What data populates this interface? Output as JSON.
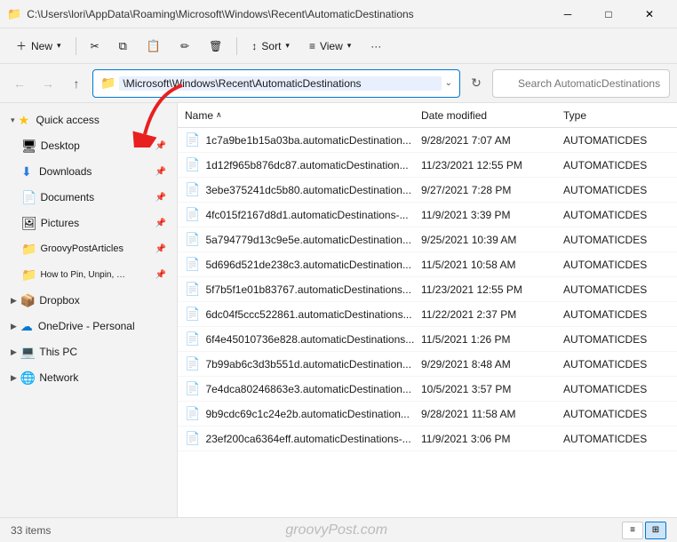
{
  "titleBar": {
    "path": "C:\\Users\\lori\\AppData\\Roaming\\Microsoft\\Windows\\Recent\\AutomaticDestinations",
    "minBtn": "─",
    "maxBtn": "□",
    "closeBtn": "✕"
  },
  "toolbar": {
    "newLabel": "+ New",
    "cutIcon": "✂",
    "copyIcon": "⧉",
    "pasteIcon": "📋",
    "renameIcon": "✏",
    "deleteIcon": "🗑",
    "sortLabel": "↕ Sort",
    "viewLabel": "≡ View",
    "moreLabel": "···",
    "newDropIcon": "▾"
  },
  "addressBar": {
    "backTitle": "Back",
    "forwardTitle": "Forward",
    "upTitle": "Up",
    "addressText": "\\Microsoft\\Windows\\Recent\\AutomaticDestinations",
    "searchPlaceholder": "Search AutomaticDestinations",
    "refreshTitle": "Refresh"
  },
  "sidebar": {
    "quickAccessLabel": "Quick access",
    "items": [
      {
        "id": "desktop",
        "label": "Desktop",
        "icon": "🖥",
        "pinned": true
      },
      {
        "id": "downloads",
        "label": "Downloads",
        "icon": "⬇",
        "pinned": true
      },
      {
        "id": "documents",
        "label": "Documents",
        "icon": "📄",
        "pinned": true
      },
      {
        "id": "pictures",
        "label": "Pictures",
        "icon": "🖼",
        "pinned": true
      },
      {
        "id": "groovypostarticles",
        "label": "GroovyPostArticles",
        "icon": "📁",
        "pinned": true
      },
      {
        "id": "howtopin",
        "label": "How to Pin, Unpin, Hide, and Re",
        "icon": "📁",
        "pinned": true
      }
    ],
    "dropbox": {
      "label": "Dropbox",
      "icon": "📦"
    },
    "onedrive": {
      "label": "OneDrive - Personal",
      "icon": "☁"
    },
    "thispc": {
      "label": "This PC",
      "icon": "💻"
    },
    "network": {
      "label": "Network",
      "icon": "🌐"
    }
  },
  "fileList": {
    "headers": {
      "name": "Name",
      "dateModified": "Date modified",
      "type": "Type"
    },
    "sortArrow": "∧",
    "files": [
      {
        "name": "1c7a9be1b15a03ba.automaticDestination...",
        "date": "9/28/2021 7:07 AM",
        "type": "AUTOMATICDES"
      },
      {
        "name": "1d12f965b876dc87.automaticDestination...",
        "date": "11/23/2021 12:55 PM",
        "type": "AUTOMATICDES"
      },
      {
        "name": "3ebe375241dc5b80.automaticDestination...",
        "date": "9/27/2021 7:28 PM",
        "type": "AUTOMATICDES"
      },
      {
        "name": "4fc015f2167d8d1.automaticDestinations-...",
        "date": "11/9/2021 3:39 PM",
        "type": "AUTOMATICDES"
      },
      {
        "name": "5a794779d13c9e5e.automaticDestination...",
        "date": "9/25/2021 10:39 AM",
        "type": "AUTOMATICDES"
      },
      {
        "name": "5d696d521de238c3.automaticDestination...",
        "date": "11/5/2021 10:58 AM",
        "type": "AUTOMATICDES"
      },
      {
        "name": "5f7b5f1e01b83767.automaticDestinations...",
        "date": "11/23/2021 12:55 PM",
        "type": "AUTOMATICDES"
      },
      {
        "name": "6dc04f5ccc522861.automaticDestinations...",
        "date": "11/22/2021 2:37 PM",
        "type": "AUTOMATICDES"
      },
      {
        "name": "6f4e45010736e828.automaticDestinations...",
        "date": "11/5/2021 1:26 PM",
        "type": "AUTOMATICDES"
      },
      {
        "name": "7b99ab6c3d3b551d.automaticDestination...",
        "date": "9/29/2021 8:48 AM",
        "type": "AUTOMATICDES"
      },
      {
        "name": "7e4dca80246863e3.automaticDestination...",
        "date": "10/5/2021 3:57 PM",
        "type": "AUTOMATICDES"
      },
      {
        "name": "9b9cdc69c1c24e2b.automaticDestination...",
        "date": "9/28/2021 11:58 AM",
        "type": "AUTOMATICDES"
      },
      {
        "name": "23ef200ca6364eff.automaticDestinations-...",
        "date": "11/9/2021 3:06 PM",
        "type": "AUTOMATICDES"
      }
    ]
  },
  "statusBar": {
    "count": "33 items",
    "watermark": "groovyPost.com"
  }
}
